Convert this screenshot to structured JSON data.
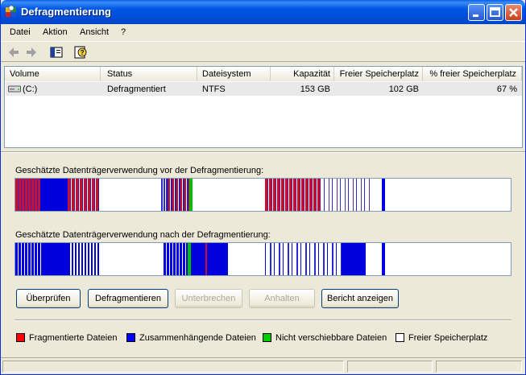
{
  "window": {
    "title": "Defragmentierung"
  },
  "menu": [
    "Datei",
    "Aktion",
    "Ansicht",
    "?"
  ],
  "icons": {
    "app": "defrag-app-icon",
    "back": "back-arrow-icon",
    "forward": "forward-arrow-icon",
    "show_hide": "show-hide-console-tree-icon",
    "help": "help-icon"
  },
  "columns": [
    "Volume",
    "Status",
    "Dateisystem",
    "Kapazität",
    "Freier Speicherplatz",
    "% freier Speicherplatz"
  ],
  "volumes": [
    {
      "volume": "(C:)",
      "status": "Defragmentiert",
      "filesystem": "NTFS",
      "capacity": "153 GB",
      "free": "102 GB",
      "free_pct": "67 %"
    }
  ],
  "labels": {
    "before": "Geschätzte Datenträgerverwendung vor der Defragmentierung:",
    "after": "Geschätzte Datenträgerverwendung nach der Defragmentierung:"
  },
  "buttons": {
    "check": "Überprüfen",
    "defrag": "Defragmentieren",
    "interrupt": "Unterbrechen",
    "pause": "Anhalten",
    "report": "Bericht anzeigen"
  },
  "legend": [
    {
      "label": "Fragmentierte Dateien",
      "color": "#ff0000"
    },
    {
      "label": "Zusammenhängende Dateien",
      "color": "#0000ff"
    },
    {
      "label": "Nicht verschiebbare Dateien",
      "color": "#00cc00"
    },
    {
      "label": "Freier Speicherplatz",
      "color": "#ffffff"
    }
  ],
  "colors": {
    "fragmented": "#cc1133",
    "contiguous": "#0000dd",
    "unmovable": "#00c000",
    "free": "#ffffff",
    "titlebar": "#0054e3"
  }
}
